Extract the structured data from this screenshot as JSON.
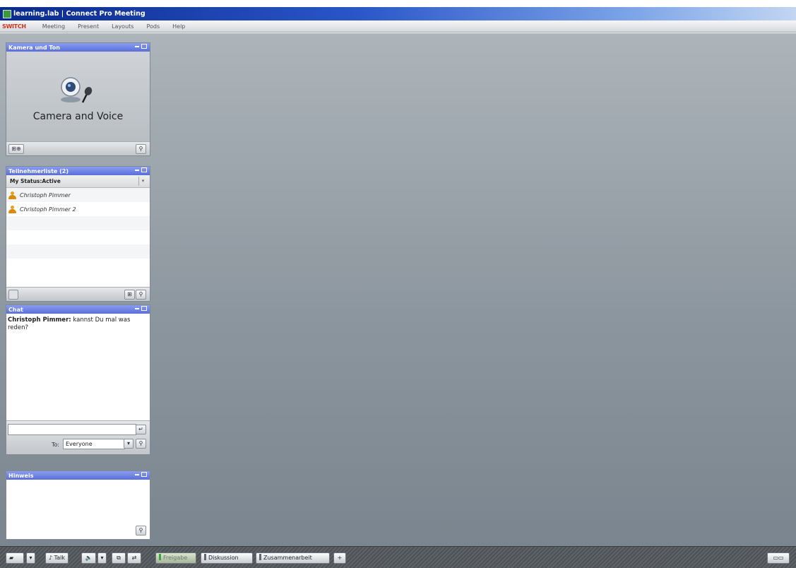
{
  "window": {
    "title": "learning.lab | Connect Pro Meeting"
  },
  "menubar": {
    "brand": "SWITCH",
    "items": [
      "Meeting",
      "Present",
      "Layouts",
      "Pods",
      "Help"
    ]
  },
  "pods": {
    "camera": {
      "title": "Kamera und Ton",
      "label": "Camera and Voice",
      "toolbar_button": "⊞⊕",
      "icons": [
        "webcam-icon",
        "microphone-icon"
      ]
    },
    "attendees": {
      "title": "Teilnehmerliste (2)",
      "my_status": "My Status:Active",
      "people": [
        "Christoph Pimmer",
        "Christoph Pimmer 2"
      ]
    },
    "chat": {
      "title": "Chat",
      "messages": [
        {
          "sender": "Christoph Pimmer:",
          "text": " kannst Du mal was reden?"
        }
      ],
      "input_value": "",
      "to_label": "To:",
      "to_value": "Everyone"
    },
    "notes": {
      "title": "Hinweis"
    }
  },
  "taskbar": {
    "talk_label": "Talk",
    "tabs": [
      "Freigabe",
      "Diskussion",
      "Zusammenarbeit"
    ],
    "active_tab": "Freigabe",
    "add_label": "+"
  }
}
